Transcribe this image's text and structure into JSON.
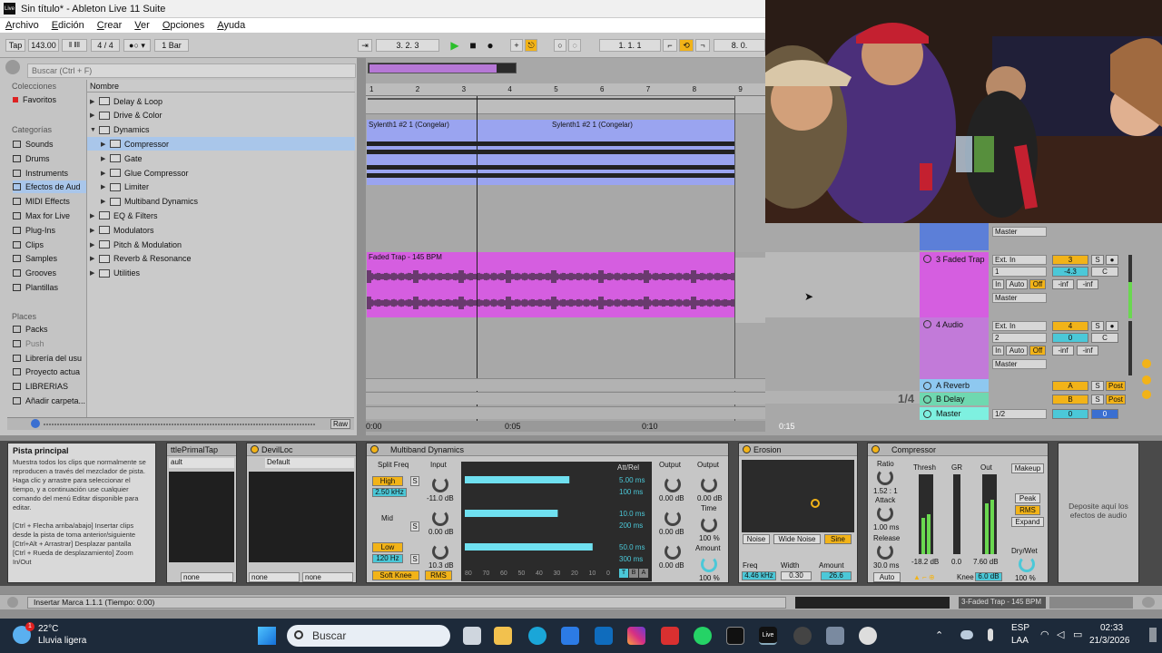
{
  "window": {
    "title": "Sin título* - Ableton Live 11 Suite",
    "logo_text": "Live"
  },
  "menu": [
    "Archivo",
    "Edición",
    "Crear",
    "Ver",
    "Opciones",
    "Ayuda"
  ],
  "control_bar": {
    "tap": "Tap",
    "tempo": "143.00",
    "signature": "4 / 4",
    "quantize": "1 Bar",
    "position": "3. 2. 3",
    "loop_start": "1. 1. 1",
    "loop_end": "8. 0."
  },
  "browser": {
    "search_placeholder": "Buscar (Ctrl + F)",
    "collections_title": "Colecciones",
    "favorites": "Favoritos",
    "categories_title": "Categorías",
    "categories": [
      "Sounds",
      "Drums",
      "Instruments",
      "Efectos de Aud",
      "MIDI Effects",
      "Max for Live",
      "Plug-Ins",
      "Clips",
      "Samples",
      "Grooves",
      "Plantillas"
    ],
    "places_title": "Places",
    "places": [
      "Packs",
      "Push",
      "Librería del usu",
      "Proyecto actua",
      "LIBRERIAS",
      "Añadir carpeta..."
    ],
    "name_header": "Nombre",
    "items": [
      {
        "label": "Delay & Loop",
        "indent": 0
      },
      {
        "label": "Drive & Color",
        "indent": 0
      },
      {
        "label": "Dynamics",
        "indent": 0
      },
      {
        "label": "Compressor",
        "indent": 1
      },
      {
        "label": "Gate",
        "indent": 1
      },
      {
        "label": "Glue Compressor",
        "indent": 1
      },
      {
        "label": "Limiter",
        "indent": 1
      },
      {
        "label": "Multiband Dynamics",
        "indent": 1
      },
      {
        "label": "EQ & Filters",
        "indent": 0
      },
      {
        "label": "Modulators",
        "indent": 0
      },
      {
        "label": "Pitch & Modulation",
        "indent": 0
      },
      {
        "label": "Reverb & Resonance",
        "indent": 0
      },
      {
        "label": "Utilities",
        "indent": 0
      }
    ],
    "raw_label": "Raw"
  },
  "arrangement": {
    "bars": [
      "1",
      "2",
      "3",
      "4",
      "5",
      "6",
      "7",
      "8",
      "9"
    ],
    "clips": {
      "sylenth_a": "Sylenth1 #2 1 (Congelar)",
      "sylenth_b": "Sylenth1 #2 1 (Congelar)",
      "faded": "Faded Trap - 145 BPM"
    },
    "time_ruler": [
      "0:00",
      "0:05",
      "0:10",
      "0:15"
    ],
    "zoom_fraction": "1/4"
  },
  "mixer": {
    "tracks": [
      {
        "name": "3 Faded Trap",
        "input": "Ext. In",
        "channel": "1",
        "number": "3",
        "volume": "-4.3",
        "pan": "C",
        "out": "Master"
      },
      {
        "name": "4 Audio",
        "input": "Ext. In",
        "channel": "2",
        "number": "4",
        "volume": "0",
        "pan": "C",
        "out": "Master"
      }
    ],
    "top_out": "Master",
    "monitor": {
      "in": "In",
      "auto": "Auto",
      "off": "Off"
    },
    "inf": "-inf",
    "returns": [
      {
        "name": "A Reverb",
        "letter": "A",
        "post": "Post"
      },
      {
        "name": "B Delay",
        "letter": "B",
        "post": "Post"
      }
    ],
    "master": {
      "name": "Master",
      "out": "1/2",
      "volume": "0",
      "pan": "0"
    }
  },
  "devices": {
    "info": {
      "title": "Pista principal",
      "text": "Muestra todos los clips que normalmente se reproducen a través del mezclador de pista. Haga clic y arrastre para seleccionar el tiempo, y a continuación use cualquier comando del menú Editar disponible para editar.\n\n[Ctrl + Flecha arriba/abajo] Insertar clips desde la pista de toma anterior/siguiente\n[Ctrl+Alt + Arrastrar] Desplazar pantalla\n[Ctrl + Rueda de desplazamiento] Zoom In/Out"
    },
    "plugin1": {
      "title": "ttlePrimalTap",
      "preset": "ault",
      "none": "none"
    },
    "plugin2": {
      "title": "DevilLoc",
      "preset": "Default",
      "none": "none"
    },
    "multiband": {
      "title": "Multiband Dynamics",
      "split_freq": "Split Freq",
      "input": "Input",
      "high": "High",
      "high_freq": "2.50 kHz",
      "mid": "Mid",
      "low": "Low",
      "low_freq": "120 Hz",
      "s": "S",
      "input_vals": [
        "-11.0 dB",
        "0.00 dB",
        "10.3 dB"
      ],
      "att_rel_title": "Att/Rel",
      "att_rel": [
        "5.00 ms",
        "100 ms",
        "10.0 ms",
        "200 ms",
        "50.0 ms",
        "300 ms"
      ],
      "output": "Output",
      "output_vals": [
        "0.00 dB",
        "0.00 dB",
        "0.00 dB"
      ],
      "output2": "Output",
      "output2_val": "0.00 dB",
      "time": "Time",
      "time_val": "100 %",
      "amount": "Amount",
      "amount_val": "100 %",
      "soft_knee": "Soft Knee",
      "rms": "RMS",
      "scale": [
        "80",
        "70",
        "60",
        "50",
        "40",
        "30",
        "20",
        "10",
        "0"
      ],
      "tbs": [
        "T",
        "B",
        "A"
      ],
      "bands": [
        0.72,
        0.64,
        0.88
      ]
    },
    "erosion": {
      "title": "Erosion",
      "noise": "Noise",
      "wide_noise": "Wide Noise",
      "sine": "Sine",
      "freq": "Freq",
      "freq_val": "4.46 kHz",
      "width": "Width",
      "width_val": "0.30",
      "amount": "Amount",
      "amount_val": "26.6"
    },
    "compressor": {
      "title": "Compressor",
      "ratio": "Ratio",
      "ratio_val": "1.52 : 1",
      "attack": "Attack",
      "attack_val": "1.00 ms",
      "release": "Release",
      "release_val": "30.0 ms",
      "auto": "Auto",
      "thresh": "Thresh",
      "gr": "GR",
      "out": "Out",
      "thresh_val": "-18.2 dB",
      "gr_val": "0.0",
      "out_val": "7.60 dB",
      "makeup": "Makeup",
      "peak": "Peak",
      "rms": "RMS",
      "expand": "Expand",
      "knee": "Knee",
      "knee_val": "6.0 dB",
      "dry_wet": "Dry/Wet",
      "dry_wet_val": "100 %"
    },
    "drop_hint": "Deposite aquí los efectos de audio"
  },
  "status": {
    "text": "Insertar Marca 1.1.1 (Tiempo: 0:00)",
    "track": "3-Faded Trap - 145 BPM"
  },
  "taskbar": {
    "weather_temp": "22°C",
    "weather_desc": "Lluvia ligera",
    "badge": "1",
    "search": "Buscar",
    "lang": "ESP",
    "lang2": "LAA",
    "time": "02:33",
    "date": "21/3/2026"
  }
}
